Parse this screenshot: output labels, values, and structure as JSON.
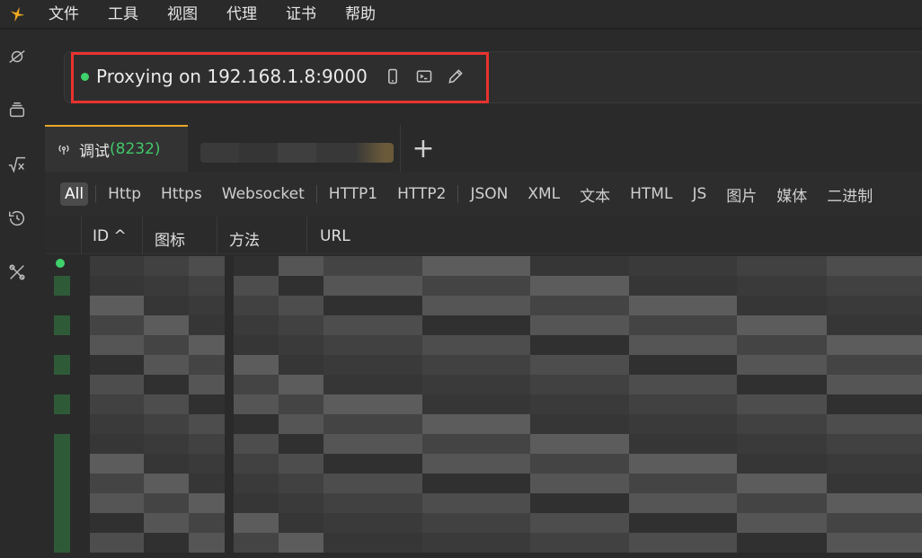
{
  "menubar": {
    "items": [
      "文件",
      "工具",
      "视图",
      "代理",
      "证书",
      "帮助"
    ]
  },
  "sidebar": {
    "icons": [
      "satellite-icon",
      "layers-icon",
      "formula-icon",
      "history-icon",
      "tools-icon"
    ]
  },
  "proxy": {
    "status_text": "Proxying on 192.168.1.8:9000",
    "status_color": "#3fd16b",
    "highlight_color": "#e8332f",
    "icons": [
      "phone-icon",
      "terminal-icon",
      "edit-icon"
    ]
  },
  "tabs": {
    "active_label": "调试",
    "active_count": "(8232)",
    "add_label": "+"
  },
  "filters": {
    "items": [
      "All",
      "Http",
      "Https",
      "Websocket",
      "HTTP1",
      "HTTP2",
      "JSON",
      "XML",
      "文本",
      "HTML",
      "JS",
      "图片",
      "媒体",
      "二进制"
    ],
    "active": "All"
  },
  "table": {
    "columns": [
      "ID ^",
      "图标",
      "方法",
      "URL"
    ]
  },
  "colors": {
    "accent": "#e8a825",
    "count": "#41c86a"
  }
}
